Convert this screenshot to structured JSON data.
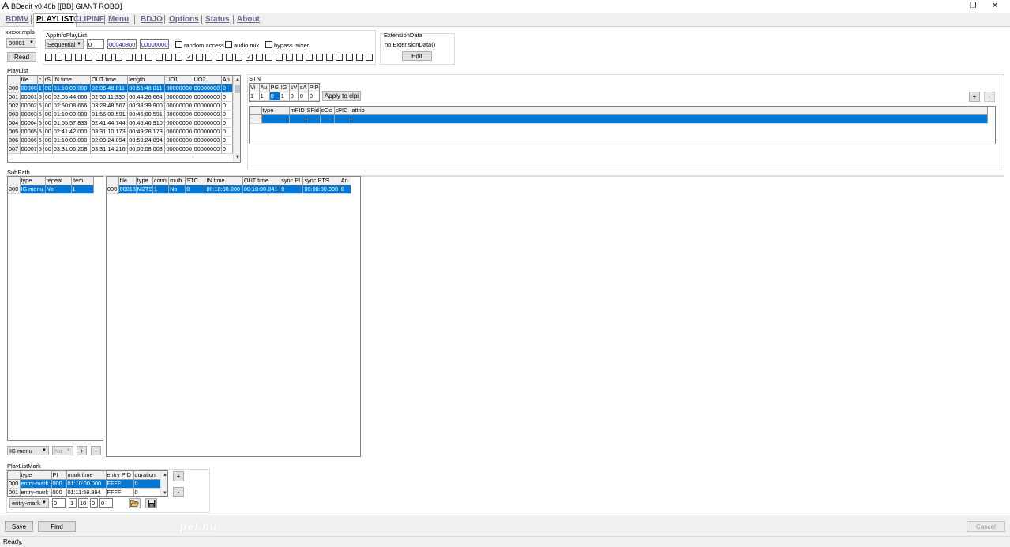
{
  "window": {
    "title": "BDedit v0.40b [[BD] GIANT ROBO]",
    "controls": {
      "minimize": "—",
      "restore": "❐",
      "close": "✕"
    }
  },
  "tabs": [
    "BDMV",
    "PLAYLIST",
    "CLIPINF",
    "Menu",
    "BDJO",
    "Options",
    "Status",
    "About"
  ],
  "active_tab": "PLAYLIST",
  "file_section": {
    "label": "xxxxx.mpls",
    "selected_file": "00001",
    "read_button": "Read"
  },
  "app_info": {
    "label": "AppInfoPlayList",
    "playback_type": "Sequential",
    "field1": "0",
    "field2": "00040800",
    "field3": "00000000",
    "random_access_label": "random access",
    "audio_mix_label": "audio mix",
    "bypass_mixer_label": "bypass mixer",
    "uo_flags": [
      false,
      false,
      false,
      false,
      false,
      false,
      false,
      false,
      false,
      false,
      false,
      false,
      false,
      false,
      true,
      false,
      false,
      false,
      false,
      false,
      true,
      false,
      false,
      false,
      false,
      false,
      false,
      false,
      false,
      false,
      false,
      false,
      false
    ]
  },
  "extension": {
    "label": "ExtensionData",
    "value": "no ExtensionData()",
    "edit_button": "Edit"
  },
  "playlist": {
    "label": "PlayList",
    "headers": [
      "",
      "file",
      "c",
      "rS",
      "IN time",
      "OUT time",
      "length",
      "UO1",
      "UO2",
      "An"
    ],
    "rows": [
      [
        "000",
        "00000",
        "1",
        "00",
        "01:10:00.000",
        "02:05:48.011",
        "00:55:48.011",
        "00000000",
        "00000000",
        "0"
      ],
      [
        "001",
        "00001",
        "5",
        "00",
        "02:05:44.666",
        "02:50:11.330",
        "00:44:26.664",
        "00000000",
        "00000000",
        "0"
      ],
      [
        "002",
        "00002",
        "5",
        "00",
        "02:50:08.666",
        "03:28:48.567",
        "00:38:39.900",
        "00000000",
        "00000000",
        "0"
      ],
      [
        "003",
        "00003",
        "5",
        "00",
        "01:10:00.000",
        "01:56:00.591",
        "00:46:00.591",
        "00000000",
        "00000000",
        "0"
      ],
      [
        "004",
        "00004",
        "5",
        "00",
        "01:55:57.833",
        "02:41:44.744",
        "00:45:46.910",
        "00000000",
        "00000000",
        "0"
      ],
      [
        "005",
        "00005",
        "5",
        "00",
        "02:41:42.000",
        "03:31:10.173",
        "00:49:28.173",
        "00000000",
        "00000000",
        "0"
      ],
      [
        "006",
        "00006",
        "5",
        "00",
        "01:10:00.000",
        "02:09:24.894",
        "00:59:24.894",
        "00000000",
        "00000000",
        "0"
      ],
      [
        "007",
        "00007",
        "5",
        "00",
        "03:31:06.208",
        "03:31:14.216",
        "00:00:08.008",
        "00000000",
        "00000000",
        "0"
      ]
    ]
  },
  "stn": {
    "label": "STN",
    "headers": [
      "Vi",
      "Au",
      "PG",
      "IG",
      "sV",
      "sA",
      "PIP"
    ],
    "values": [
      "1",
      "1",
      "0",
      "1",
      "0",
      "0",
      "0"
    ],
    "apply_button": "Apply to clpi",
    "add_button": "+",
    "remove_button": "-",
    "stream_headers": [
      "",
      "type",
      "mPID",
      "SPid",
      "sCid",
      "sPID",
      "attrib"
    ]
  },
  "subpath": {
    "label": "SubPath",
    "headers": [
      "",
      "type",
      "repeat",
      "item"
    ],
    "rows": [
      [
        "000",
        "IG menu",
        "No",
        "1"
      ]
    ],
    "type_select": "IG menu",
    "repeat_select": "No",
    "add_button": "+",
    "remove_button": "-"
  },
  "subplayitem": {
    "headers": [
      "",
      "file",
      "type",
      "conn",
      "multi",
      "STC",
      "IN time",
      "OUT time",
      "sync PI",
      "sync PTS",
      "An"
    ],
    "rows": [
      [
        "000",
        "00013",
        "M2TS",
        "1",
        "No",
        "0",
        "00:10:00.000",
        "00:10:00.041",
        "0",
        "00:00:00.000",
        "0"
      ]
    ]
  },
  "playlistmark": {
    "label": "PlayListMark",
    "headers": [
      "",
      "type",
      "PI",
      "mark time",
      "entry PID",
      "duration"
    ],
    "rows": [
      [
        "000",
        "entry-mark",
        "000",
        "01:10:00.000",
        "FFFF",
        "0"
      ],
      [
        "001",
        "entry-mark",
        "000",
        "01:11:59.994",
        "FFFF",
        "0"
      ]
    ],
    "type_select": "entry-mark",
    "edit_fields": [
      "0",
      "1",
      "10",
      "0",
      "0"
    ],
    "add_button": "+",
    "remove_button": "-"
  },
  "footer": {
    "save_button": "Save",
    "find_button": "Find",
    "cancel_button": "Cancel",
    "watermark": "pel.hu"
  },
  "status_text": "Ready."
}
